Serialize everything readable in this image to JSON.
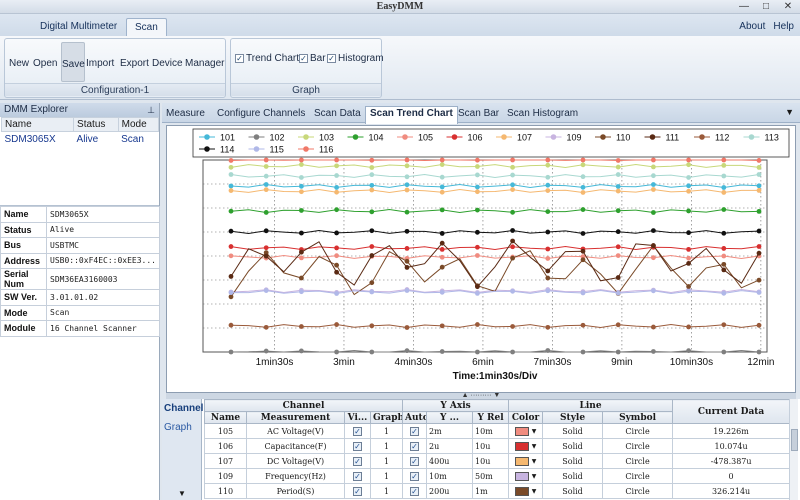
{
  "window": {
    "title": "EasyDMM",
    "controls": [
      "—",
      "□",
      "✕"
    ]
  },
  "ribbon": {
    "tabs": [
      "Digital Multimeter",
      "Scan"
    ],
    "right_links": [
      "About",
      "Help"
    ],
    "config_group": {
      "label": "Configuration-1",
      "buttons": [
        "New",
        "Open",
        "Save",
        "Import",
        "Export",
        "Device",
        "Manager"
      ]
    },
    "graph_group": {
      "label": "Graph",
      "checks": [
        "Trend Chart",
        "Bar",
        "Histogram"
      ]
    }
  },
  "explorer": {
    "title": "DMM Explorer",
    "headers": [
      "Name",
      "Status",
      "Mode"
    ],
    "row": [
      "SDM3065X",
      "Alive",
      "Scan"
    ]
  },
  "properties": [
    [
      "Name",
      "SDM3065X"
    ],
    [
      "Status",
      "Alive"
    ],
    [
      "Bus",
      "USBTMC"
    ],
    [
      "Address",
      "USB0::0xF4EC::0xEE3..."
    ],
    [
      "Serial Num",
      "SDM36EA3160003"
    ],
    [
      "SW Ver.",
      "3.01.01.02"
    ],
    [
      "Mode",
      "Scan"
    ],
    [
      "Module",
      "16 Channel Scanner"
    ]
  ],
  "doc_tabs": [
    "Measure",
    "Configure Channels",
    "Scan Data",
    "Scan Trend Chart",
    "Scan Bar",
    "Scan Histogram"
  ],
  "chart_data": {
    "type": "line",
    "xlabel": "Time:1min30s/Div",
    "x_ticks": [
      "1min30s",
      "3min",
      "4min30s",
      "6min",
      "7min30s",
      "9min",
      "10min30s",
      "12min"
    ],
    "legend_placement": "top",
    "grid": true,
    "series": [
      {
        "name": "101",
        "color": "#45b8d8"
      },
      {
        "name": "102",
        "color": "#7f7f7f"
      },
      {
        "name": "103",
        "color": "#c8d87a"
      },
      {
        "name": "104",
        "color": "#2ea02e"
      },
      {
        "name": "105",
        "color": "#f08c80"
      },
      {
        "name": "106",
        "color": "#d83030"
      },
      {
        "name": "107",
        "color": "#f5b870"
      },
      {
        "name": "109",
        "color": "#c8b4e0"
      },
      {
        "name": "110",
        "color": "#7a4a28"
      },
      {
        "name": "111",
        "color": "#5a2a14"
      },
      {
        "name": "112",
        "color": "#9a5a3a"
      },
      {
        "name": "113",
        "color": "#a8d8d0"
      },
      {
        "name": "114",
        "color": "#101010"
      },
      {
        "name": "115",
        "color": "#b0b8e8"
      },
      {
        "name": "116",
        "color": "#f07868"
      }
    ]
  },
  "sidetabs": [
    "Channel",
    "Graph"
  ],
  "grid": {
    "group_headers": [
      "Channel",
      "Y Axis",
      "Line"
    ],
    "headers": [
      "Name",
      "Measurement",
      "Vi...",
      "Graph",
      "Auto",
      "Y ...",
      "Y Rel",
      "Color",
      "Style",
      "Symbol",
      "Current Data"
    ],
    "rows": [
      [
        "105",
        "AC Voltage(V)",
        "1",
        "2m",
        "10m",
        "#f08c80",
        "Solid",
        "Circle",
        "19.226m"
      ],
      [
        "106",
        "Capacitance(F)",
        "1",
        "2u",
        "10u",
        "#d83030",
        "Solid",
        "Circle",
        "10.074u"
      ],
      [
        "107",
        "DC Voltage(V)",
        "1",
        "400u",
        "10u",
        "#f5b870",
        "Solid",
        "Circle",
        "-478.387u"
      ],
      [
        "109",
        "Frequency(Hz)",
        "1",
        "10m",
        "50m",
        "#c8b4e0",
        "Solid",
        "Circle",
        "0"
      ],
      [
        "110",
        "Period(S)",
        "1",
        "200u",
        "1m",
        "#7a4a28",
        "Solid",
        "Circle",
        "326.214u"
      ]
    ]
  }
}
